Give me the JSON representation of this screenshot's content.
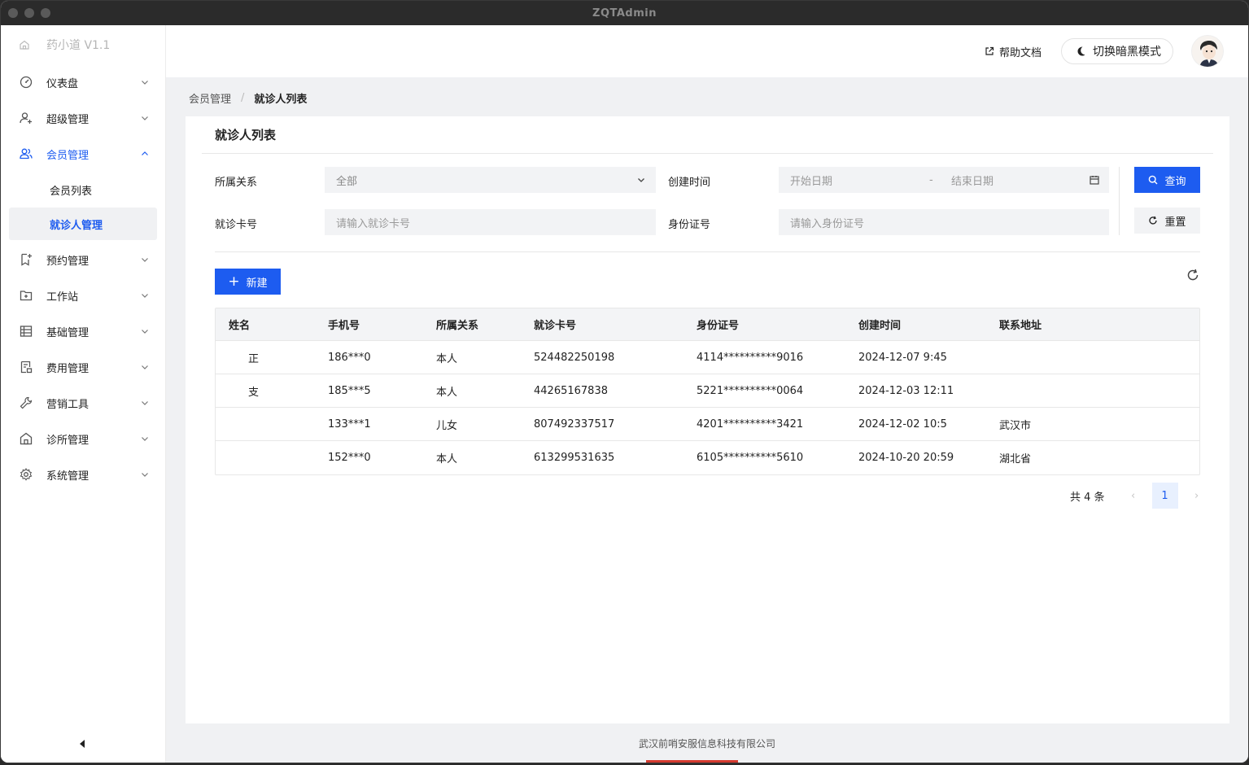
{
  "window": {
    "title": "ZQTAdmin"
  },
  "sidebar": {
    "logo": "药小道 V1.1",
    "items": [
      {
        "label": "仪表盘",
        "icon": "dashboard-icon"
      },
      {
        "label": "超级管理",
        "icon": "user-add-icon"
      },
      {
        "label": "会员管理",
        "icon": "users-icon",
        "expanded": true
      },
      {
        "label": "预约管理",
        "icon": "bookmark-icon"
      },
      {
        "label": "工作站",
        "icon": "folder-add-icon"
      },
      {
        "label": "基础管理",
        "icon": "table-icon"
      },
      {
        "label": "费用管理",
        "icon": "form-icon"
      },
      {
        "label": "营销工具",
        "icon": "wrench-icon"
      },
      {
        "label": "诊所管理",
        "icon": "house-icon"
      },
      {
        "label": "系统管理",
        "icon": "gear-icon"
      }
    ],
    "sub_items": [
      {
        "label": "会员列表"
      },
      {
        "label": "就诊人管理",
        "selected": true
      }
    ]
  },
  "header": {
    "help_label": "帮助文档",
    "dark_mode_label": "切换暗黑模式"
  },
  "breadcrumb": {
    "parent": "会员管理",
    "current": "就诊人列表"
  },
  "card": {
    "title": "就诊人列表"
  },
  "filters": {
    "relation_label": "所属关系",
    "relation_value": "全部",
    "created_label": "创建时间",
    "start_placeholder": "开始日期",
    "date_sep": "-",
    "end_placeholder": "结束日期",
    "card_label": "就诊卡号",
    "card_placeholder": "请输入就诊卡号",
    "id_label": "身份证号",
    "id_placeholder": "请输入身份证号",
    "query_label": "查询",
    "reset_label": "重置"
  },
  "toolbar": {
    "new_label": "新建"
  },
  "table": {
    "columns": [
      "姓名",
      "手机号",
      "所属关系",
      "就诊卡号",
      "身份证号",
      "创建时间",
      "联系地址"
    ],
    "rows": [
      [
        "正",
        "186***0",
        "本人",
        "524482250198",
        "4114**********9016",
        "2024-12-07 9:45",
        ""
      ],
      [
        "支",
        "185***5",
        "本人",
        "44265167838",
        "5221**********0064",
        "2024-12-03 12:11",
        ""
      ],
      [
        "",
        "133***1",
        "儿女",
        "807492337517",
        "4201**********3421",
        "2024-12-02 10:5",
        "武汉市"
      ],
      [
        "",
        "152***0",
        "本人",
        "613299531635",
        "6105**********5610",
        "2024-10-20 20:59",
        "湖北省"
      ]
    ]
  },
  "pagination": {
    "total_label": "共 4 条",
    "current_page": "1"
  },
  "footer": {
    "company": "武汉前哨安服信息科技有限公司"
  },
  "colors": {
    "primary": "#1d5cf0",
    "bg": "#f0f1f3"
  }
}
